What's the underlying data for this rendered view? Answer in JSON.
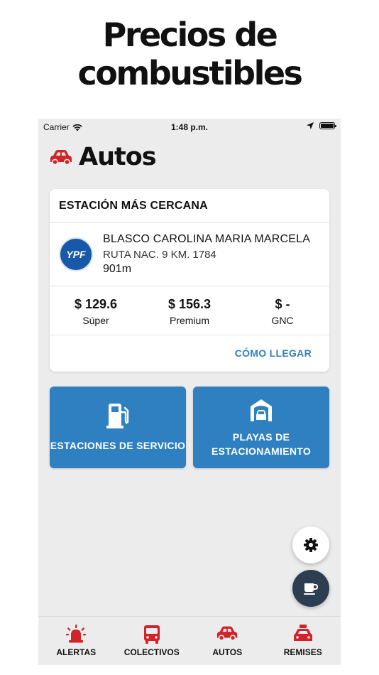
{
  "promo": {
    "line1": "Precios de",
    "line2": "combustibles"
  },
  "status_bar": {
    "carrier": "Carrier",
    "time": "1:48 p.m."
  },
  "header": {
    "title": "Autos",
    "icon": "car-icon"
  },
  "nearest_station": {
    "heading": "ESTACIÓN MÁS CERCANA",
    "brand": "YPF",
    "name": "BLASCO CAROLINA MARIA MARCELA",
    "address": "RUTA NAC. 9 KM. 1784",
    "distance": "901m",
    "prices": [
      {
        "value": "$ 129.6",
        "label": "Súper"
      },
      {
        "value": "$ 156.3",
        "label": "Premium"
      },
      {
        "value": "$ -",
        "label": "GNC"
      }
    ],
    "directions_label": "CÓMO LLEGAR"
  },
  "tiles": [
    {
      "label": "ESTACIONES DE SERVICIO",
      "icon": "fuel-pump-icon"
    },
    {
      "label_line1": "PLAYAS DE",
      "label_line2": "ESTACIONAMIENTO",
      "icon": "parking-garage-icon"
    }
  ],
  "fabs": {
    "settings_icon": "gear-icon",
    "coffee_icon": "coffee-icon"
  },
  "tab_bar": [
    {
      "label": "ALERTAS",
      "icon": "alarm-light-icon"
    },
    {
      "label": "COLECTIVOS",
      "icon": "bus-icon"
    },
    {
      "label": "AUTOS",
      "icon": "car-icon"
    },
    {
      "label": "REMISES",
      "icon": "taxi-icon"
    }
  ],
  "colors": {
    "accent_red": "#d2232a",
    "primary_blue": "#2f80c0",
    "dark_fab": "#2d3e50",
    "background": "#ececec"
  }
}
